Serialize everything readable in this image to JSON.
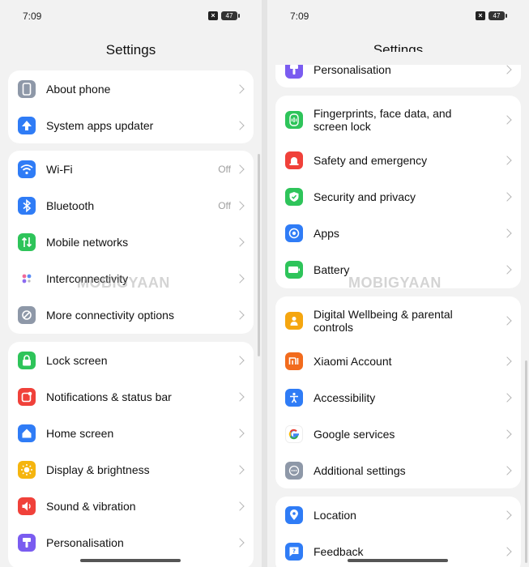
{
  "left": {
    "status": {
      "time": "7:09",
      "battery": "47"
    },
    "title": "Settings",
    "groups": [
      [
        {
          "label": "About phone",
          "icon": "phone-icon",
          "color": "#8e98a8"
        },
        {
          "label": "System apps updater",
          "icon": "arrow-up-icon",
          "color": "#2f7cf6"
        }
      ],
      [
        {
          "label": "Wi-Fi",
          "value": "Off",
          "icon": "wifi-icon",
          "color": "#2f7cf6"
        },
        {
          "label": "Bluetooth",
          "value": "Off",
          "icon": "bluetooth-icon",
          "color": "#2f7cf6"
        },
        {
          "label": "Mobile networks",
          "icon": "mobile-data-icon",
          "color": "#2ec45a"
        },
        {
          "label": "Interconnectivity",
          "icon": "dots-icon",
          "color": "#ffffff"
        },
        {
          "label": "More connectivity options",
          "icon": "link-icon",
          "color": "#8e98a8"
        }
      ],
      [
        {
          "label": "Lock screen",
          "icon": "lock-icon",
          "color": "#2ec45a"
        },
        {
          "label": "Notifications & status bar",
          "icon": "notification-icon",
          "color": "#f0413a"
        },
        {
          "label": "Home screen",
          "icon": "home-icon",
          "color": "#2f7cf6"
        },
        {
          "label": "Display & brightness",
          "icon": "sun-icon",
          "color": "#f5b50f"
        },
        {
          "label": "Sound & vibration",
          "icon": "speaker-icon",
          "color": "#f0413a"
        },
        {
          "label": "Personalisation",
          "icon": "brush-icon",
          "color": "#7a5cf0"
        }
      ]
    ],
    "watermark": "MOBIGYAAN"
  },
  "right": {
    "status": {
      "time": "7:09",
      "battery": "47"
    },
    "title": "Settings",
    "partial_row": {
      "label": "Personalisation",
      "icon": "brush-icon",
      "color": "#7a5cf0"
    },
    "groups": [
      [
        {
          "label": "Fingerprints, face data, and screen lock",
          "icon": "fingerprint-icon",
          "color": "#2ec45a"
        },
        {
          "label": "Safety and emergency",
          "icon": "emergency-icon",
          "color": "#f0413a"
        },
        {
          "label": "Security and privacy",
          "icon": "shield-icon",
          "color": "#2ec45a"
        },
        {
          "label": "Apps",
          "icon": "apps-icon",
          "color": "#2f7cf6"
        },
        {
          "label": "Battery",
          "icon": "battery-icon",
          "color": "#2ec45a"
        }
      ],
      [
        {
          "label": "Digital Wellbeing & parental controls",
          "icon": "wellbeing-icon",
          "color": "#f5a60f"
        },
        {
          "label": "Xiaomi Account",
          "icon": "xiaomi-icon",
          "color": "#f26b1d"
        },
        {
          "label": "Accessibility",
          "icon": "accessibility-icon",
          "color": "#2f7cf6"
        },
        {
          "label": "Google services",
          "icon": "google-icon",
          "color": "#ffffff"
        },
        {
          "label": "Additional settings",
          "icon": "more-icon",
          "color": "#8e98a8"
        }
      ],
      [
        {
          "label": "Location",
          "icon": "location-icon",
          "color": "#2f7cf6"
        },
        {
          "label": "Feedback",
          "icon": "feedback-icon",
          "color": "#2f7cf6"
        }
      ]
    ],
    "watermark": "MOBIGYAAN"
  }
}
